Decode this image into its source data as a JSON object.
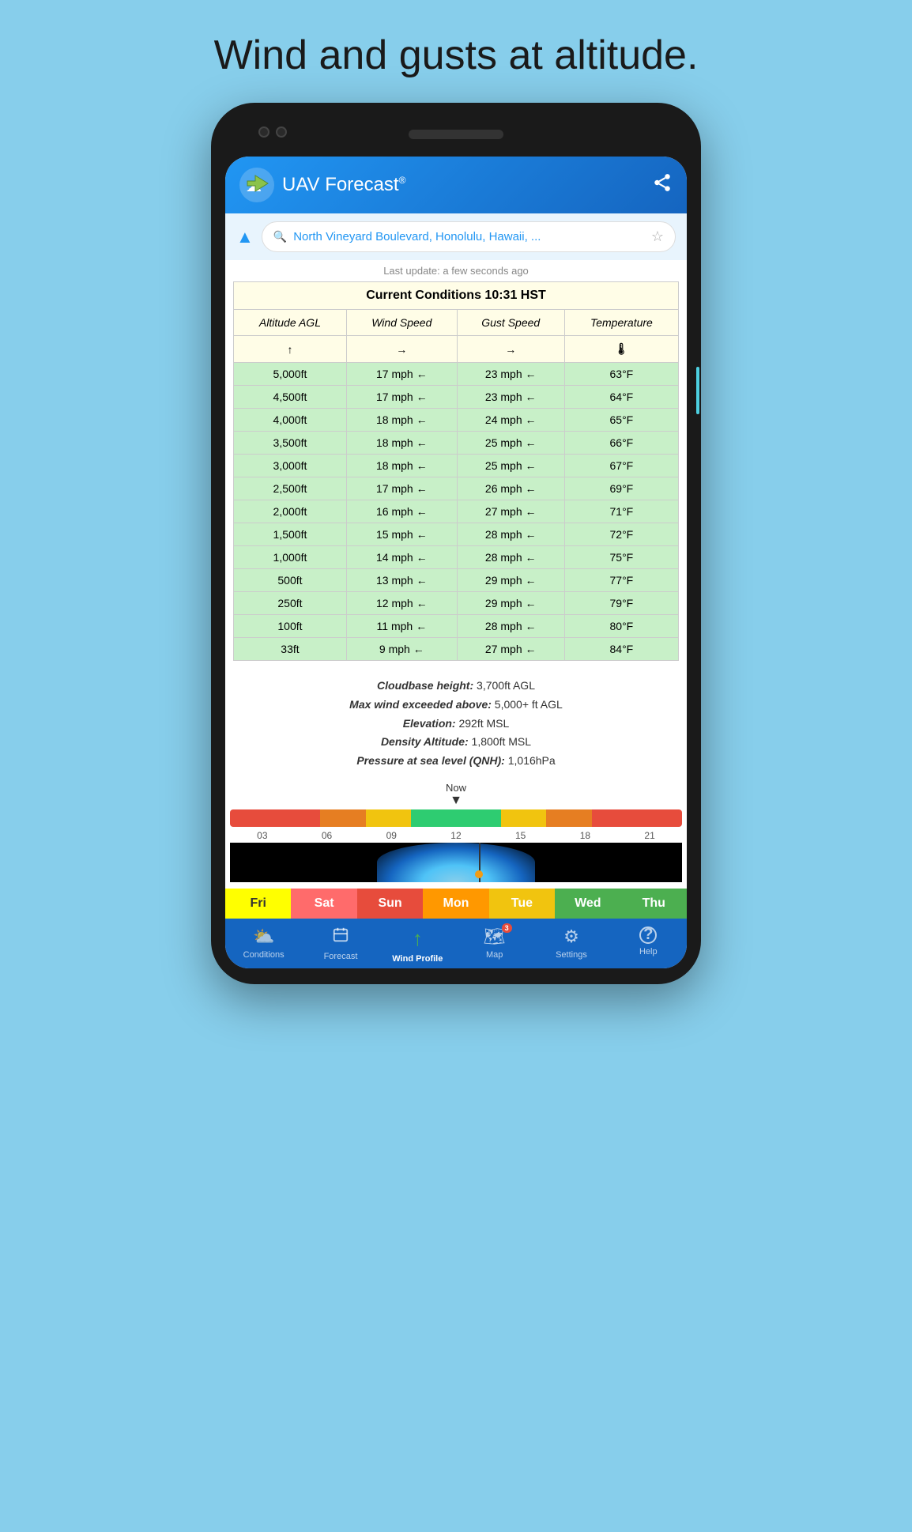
{
  "tagline": "Wind and gusts at altitude.",
  "app": {
    "title": "UAV Forecast",
    "registered": "®",
    "search_placeholder": "North Vineyard Boulevard, Honolulu, Hawaii, ...",
    "last_update": "Last update: a few seconds ago"
  },
  "table": {
    "header": "Current Conditions 10:31 HST",
    "columns": [
      "Altitude AGL",
      "Wind Speed",
      "Gust Speed",
      "Temperature"
    ],
    "col_icons": [
      "↑",
      "→",
      "→",
      "🌡"
    ],
    "rows": [
      {
        "alt": "5,000ft",
        "wind": "17 mph ←",
        "gust": "23 mph ←",
        "temp": "63°F"
      },
      {
        "alt": "4,500ft",
        "wind": "17 mph ←",
        "gust": "23 mph ←",
        "temp": "64°F"
      },
      {
        "alt": "4,000ft",
        "wind": "18 mph ←",
        "gust": "24 mph ←",
        "temp": "65°F"
      },
      {
        "alt": "3,500ft",
        "wind": "18 mph ←",
        "gust": "25 mph ←",
        "temp": "66°F"
      },
      {
        "alt": "3,000ft",
        "wind": "18 mph ←",
        "gust": "25 mph ←",
        "temp": "67°F"
      },
      {
        "alt": "2,500ft",
        "wind": "17 mph ←",
        "gust": "26 mph ←",
        "temp": "69°F"
      },
      {
        "alt": "2,000ft",
        "wind": "16 mph ←",
        "gust": "27 mph ←",
        "temp": "71°F"
      },
      {
        "alt": "1,500ft",
        "wind": "15 mph ←",
        "gust": "28 mph ←",
        "temp": "72°F"
      },
      {
        "alt": "1,000ft",
        "wind": "14 mph ←",
        "gust": "28 mph ←",
        "temp": "75°F"
      },
      {
        "alt": "500ft",
        "wind": "13 mph ←",
        "gust": "29 mph ←",
        "temp": "77°F"
      },
      {
        "alt": "250ft",
        "wind": "12 mph ←",
        "gust": "29 mph ←",
        "temp": "79°F"
      },
      {
        "alt": "100ft",
        "wind": "11 mph ←",
        "gust": "28 mph ←",
        "temp": "80°F"
      },
      {
        "alt": "33ft",
        "wind": "9 mph ←",
        "gust": "27 mph ←",
        "temp": "84°F"
      }
    ]
  },
  "info": {
    "cloudbase": "Cloudbase height: 3,700ft AGL",
    "max_wind": "Max wind exceeded above: 5,000+ ft AGL",
    "elevation": "Elevation: 292ft MSL",
    "density": "Density Altitude: 1,800ft MSL",
    "pressure": "Pressure at sea level (QNH): 1,016hPa"
  },
  "timeline": {
    "now_label": "Now",
    "hours": [
      "03",
      "06",
      "09",
      "12",
      "15",
      "18",
      "21"
    ]
  },
  "days": [
    {
      "label": "Fri",
      "style": "day-fri"
    },
    {
      "label": "Sat",
      "style": "day-sat"
    },
    {
      "label": "Sun",
      "style": "day-sun"
    },
    {
      "label": "Mon",
      "style": "day-mon"
    },
    {
      "label": "Tue",
      "style": "day-tue"
    },
    {
      "label": "Wed",
      "style": "day-wed"
    },
    {
      "label": "Thu",
      "style": "day-thu"
    }
  ],
  "nav": {
    "items": [
      {
        "id": "conditions",
        "label": "Conditions",
        "icon": "⛅",
        "active": false
      },
      {
        "id": "forecast",
        "label": "Forecast",
        "icon": "📅",
        "active": false
      },
      {
        "id": "wind",
        "label": "Wind Profile",
        "icon": "↑",
        "active": true
      },
      {
        "id": "map",
        "label": "Map",
        "icon": "🗺",
        "active": false,
        "badge": "3"
      },
      {
        "id": "settings",
        "label": "Settings",
        "icon": "⚙",
        "active": false
      },
      {
        "id": "help",
        "label": "Help",
        "icon": "?",
        "active": false
      }
    ]
  }
}
